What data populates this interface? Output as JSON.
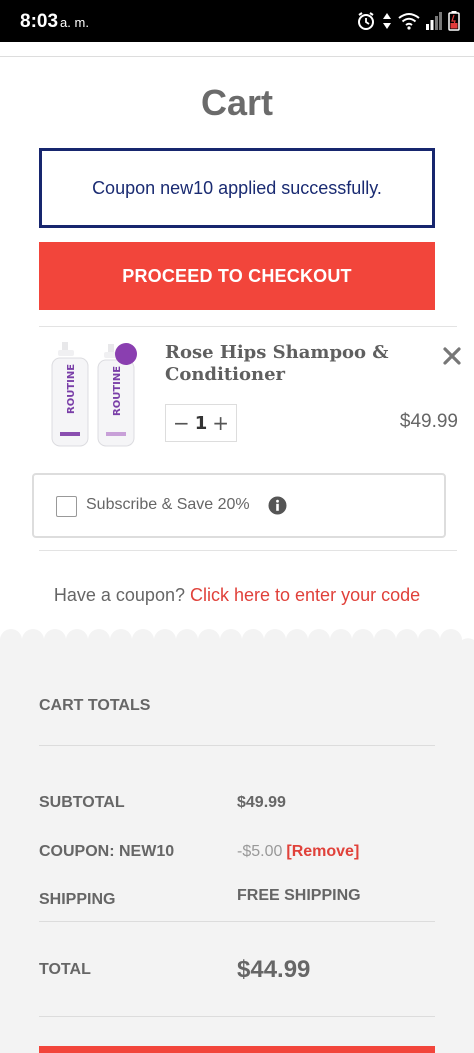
{
  "status_bar": {
    "time": "8:03",
    "ampm": "a. m."
  },
  "page": {
    "title": "Cart"
  },
  "notice": {
    "text": "Coupon new10 applied successfully."
  },
  "checkout": {
    "label": "PROCEED TO CHECKOUT"
  },
  "cart_item": {
    "name": "Rose Hips Shampoo & Conditioner",
    "quantity": "1",
    "price": "$49.99",
    "bottle_label": "ROUTINE"
  },
  "subscribe": {
    "label": "Subscribe & Save 20%",
    "checked": false
  },
  "coupon_prompt": {
    "text": "Have a coupon?",
    "link": "Click here to enter your code"
  },
  "totals": {
    "heading": "CART TOTALS",
    "subtotal_label": "SUBTOTAL",
    "subtotal_value": "$49.99",
    "coupon_label": "COUPON: NEW10",
    "coupon_value": "-$5.00",
    "coupon_remove": "[Remove]",
    "shipping_label": "SHIPPING",
    "shipping_value": "FREE SHIPPING",
    "total_label": "TOTAL",
    "total_value": "$44.99"
  },
  "colors": {
    "accent_red": "#f2453b",
    "notice_navy": "#17266e",
    "link_red": "#e0413a",
    "totals_bg": "#f3f3f3"
  }
}
